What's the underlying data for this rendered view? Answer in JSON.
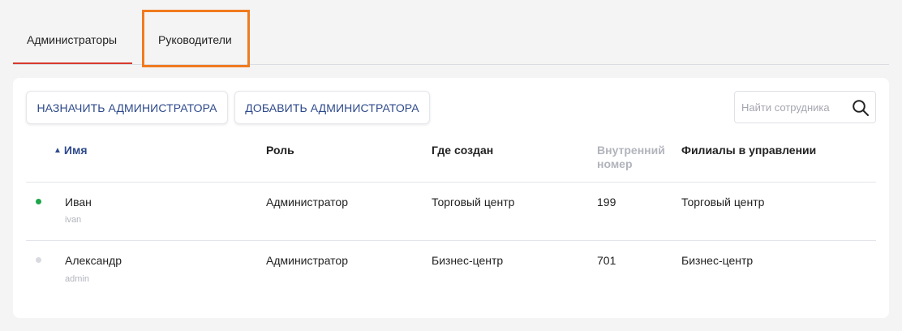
{
  "tabs": [
    {
      "label": "Администраторы",
      "active": true
    },
    {
      "label": "Руководители",
      "active": false
    }
  ],
  "colors": {
    "accent": "#2e4a8c",
    "active_tab": "#d63b2f",
    "highlight": "#f07b1f",
    "online": "#1fa64a",
    "offline": "#d9dae0"
  },
  "toolbar": {
    "assign_label": "НАЗНАЧИТЬ АДМИНИСТРАТОРА",
    "add_label": "ДОБАВИТЬ АДМИНИСТРАТОРА"
  },
  "search": {
    "placeholder": "Найти сотрудника",
    "icon": "search-icon"
  },
  "table": {
    "columns": {
      "name": "Имя",
      "role": "Роль",
      "created": "Где создан",
      "ext_line1": "Внутренний",
      "ext_line2": "номер",
      "branches": "Филиалы в управлении"
    },
    "rows": [
      {
        "status": "online",
        "name": "Иван",
        "login": "ivan",
        "role": "Администратор",
        "created": "Торговый центр",
        "ext": "199",
        "branches": "Торговый центр"
      },
      {
        "status": "offline",
        "name": "Александр",
        "login": "admin",
        "role": "Администратор",
        "created": "Бизнес-центр",
        "ext": "701",
        "branches": "Бизнес-центр"
      }
    ]
  }
}
